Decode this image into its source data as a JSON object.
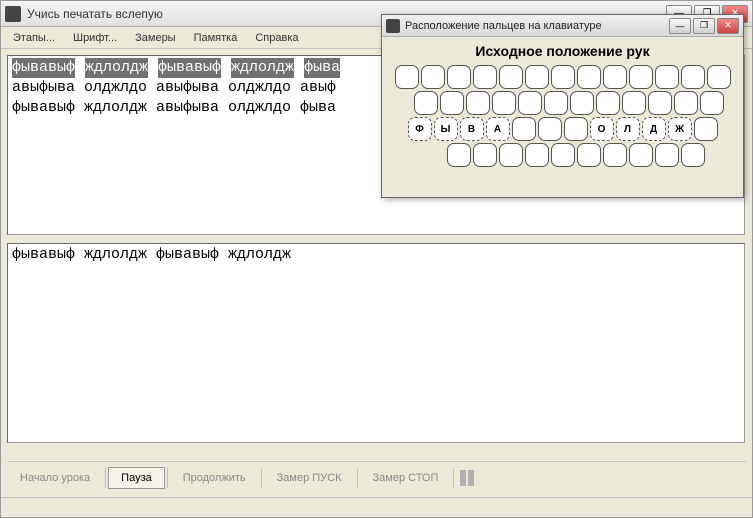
{
  "main": {
    "title": "Учись печатать вслепую",
    "menu": [
      "Этапы...",
      "Шрифт...",
      "Замеры",
      "Памятка",
      "Справка"
    ],
    "exercise": {
      "highlighted": [
        "фывавыф",
        "ждлолдж",
        "фывавыф",
        "ждлолдж",
        "фыва"
      ],
      "line2": "авыфыва олджлдо авыфыва олджлдо авыф",
      "line3": "фывавыф ждлолдж авыфыва олджлдо фыва"
    },
    "typed": "фывавыф ждлолдж фывавыф ждлолдж",
    "buttons": {
      "start": "Начало урока",
      "pause": "Пауза",
      "resume": "Продолжить",
      "measure_start": "Замер ПУСК",
      "measure_stop": "Замер СТОП"
    }
  },
  "kb": {
    "title": "Расположение пальцев на клавиатуре",
    "heading": "Исходное положение рук",
    "home_left": [
      "Ф",
      "Ы",
      "В",
      "А"
    ],
    "home_right": [
      "О",
      "Л",
      "Д",
      "Ж"
    ],
    "row_counts": {
      "r1": 13,
      "r2": 12,
      "r3": 12,
      "r4": 10
    }
  },
  "winbtns": {
    "min": "—",
    "max": "❐",
    "close": "✕"
  }
}
